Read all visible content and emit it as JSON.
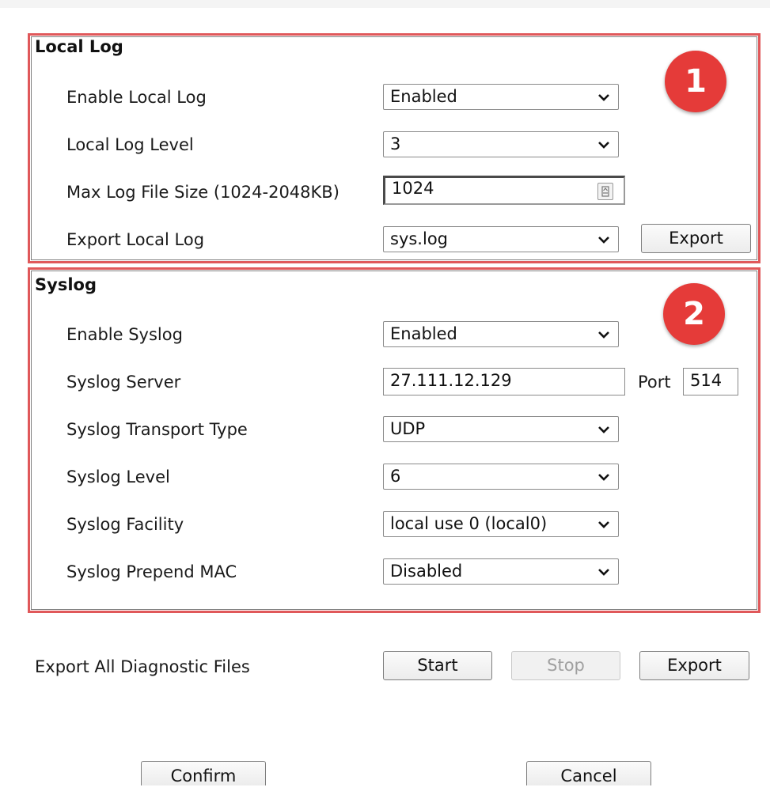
{
  "local_log": {
    "title": "Local Log",
    "badge": "1",
    "enable": {
      "label": "Enable Local Log",
      "value": "Enabled"
    },
    "level": {
      "label": "Local Log Level",
      "value": "3"
    },
    "max_size": {
      "label": "Max Log File Size (1024-2048KB)",
      "value": "1024"
    },
    "export": {
      "label": "Export Local Log",
      "value": "sys.log",
      "button": "Export"
    }
  },
  "syslog": {
    "title": "Syslog",
    "badge": "2",
    "enable": {
      "label": "Enable Syslog",
      "value": "Enabled"
    },
    "server": {
      "label": "Syslog Server",
      "value": "27.111.12.129",
      "port_label": "Port",
      "port_value": "514"
    },
    "transport": {
      "label": "Syslog Transport Type",
      "value": "UDP"
    },
    "level": {
      "label": "Syslog Level",
      "value": "6"
    },
    "facility": {
      "label": "Syslog Facility",
      "value": "local use 0 (local0)"
    },
    "prepend_mac": {
      "label": "Syslog Prepend MAC",
      "value": "Disabled"
    }
  },
  "diagnostics": {
    "label": "Export All Diagnostic Files",
    "start": "Start",
    "stop": "Stop",
    "export": "Export"
  },
  "footer": {
    "confirm": "Confirm",
    "cancel": "Cancel"
  },
  "colors": {
    "highlight_border": "#e0585a",
    "badge": "#e53b39"
  },
  "icons": {
    "dropdown": "chevron-down-icon",
    "stepper": "stepper-icon"
  }
}
